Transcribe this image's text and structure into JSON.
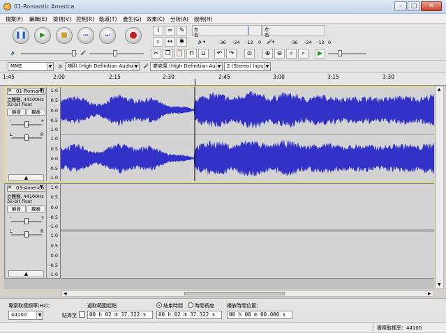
{
  "window": {
    "title": "01-Romantic America",
    "min": "–",
    "max": "□",
    "close": "✕"
  },
  "menu": [
    "檔案(F)",
    "編輯(E)",
    "檢視(V)",
    "控制(R)",
    "軌道(T)",
    "產生(G)",
    "效果(C)",
    "分析(A)",
    "說明(H)"
  ],
  "meters": {
    "channels": [
      "左",
      "右"
    ],
    "ticks": [
      "-36",
      "-24",
      "-12",
      "0"
    ]
  },
  "device": {
    "host": "MME",
    "output": "喇叭 (High Definition Audio",
    "input": "麥克風 (High Definition Au",
    "channels": "2 (Stereo) Input"
  },
  "ruler": [
    "1:45",
    "2:00",
    "2:15",
    "2:30",
    "2:45",
    "3:00",
    "3:15",
    "3:30"
  ],
  "tracks": [
    {
      "name": "01-Romanti",
      "info1": "立體聲, 44100Hz",
      "info2": "32-bit float",
      "mute": "靜音",
      "solo": "獨奏",
      "scale": [
        "1.0",
        "0.5",
        "0.0",
        "-0.5",
        "-1.0"
      ]
    },
    {
      "name": "03-America",
      "info1": "立體聲, 44100Hz",
      "info2": "32-bit float",
      "mute": "靜音",
      "solo": "獨奏",
      "scale": [
        "1.0",
        "0.5",
        "0.0",
        "-0.5",
        "-1.0"
      ]
    }
  ],
  "gain": {
    "minus": "-",
    "plus": "+",
    "left": "L",
    "right": "R"
  },
  "selection": {
    "rate_label": "專案取樣頻率(Hz)：",
    "rate_value": "44100",
    "snap_label": "貼齊至",
    "sel_label": "選取範圍起點",
    "end_label": "結束時間",
    "len_label": "時間長度",
    "pos_label": "播放時間位置：",
    "start_time": "00 h 02 m 37.322 s",
    "end_time": "00 h 02 m 37.322 s",
    "pos_time": "00 h 00 m 00.000 s"
  },
  "status": {
    "rate": "實際取樣率：44100"
  },
  "colors": {
    "wave": "#3232c8",
    "wavebg": "#d3d3d3",
    "selected_frame": "#e6dc8e"
  }
}
